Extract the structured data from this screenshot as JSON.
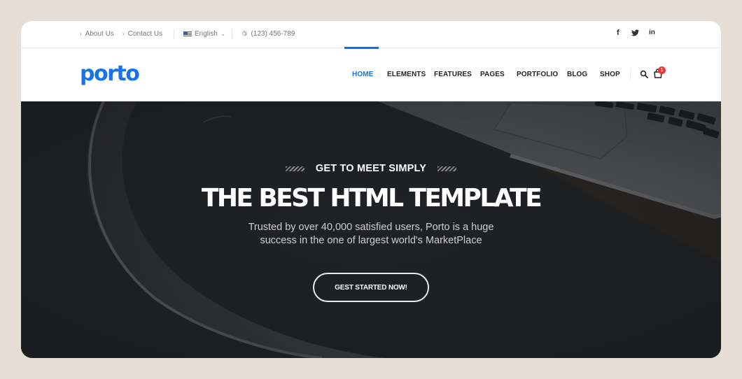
{
  "topbar": {
    "links": [
      {
        "label": "About Us",
        "icon": "chevron-right-icon"
      },
      {
        "label": "Contact Us",
        "icon": "chevron-right-icon"
      }
    ],
    "language": {
      "label": "English",
      "flag": "us-flag-icon"
    },
    "phone": "(123) 456-789",
    "social": [
      {
        "name": "facebook",
        "glyph": "f"
      },
      {
        "name": "twitter",
        "glyph": "🐦"
      },
      {
        "name": "linkedin",
        "glyph": "in"
      }
    ]
  },
  "header": {
    "logo": "porto",
    "brand_color": "#1973e8",
    "nav": [
      {
        "label": "HOME",
        "active": true
      },
      {
        "label": "ELEMENTS",
        "active": false
      },
      {
        "label": "FEATURES",
        "active": false
      },
      {
        "label": "PAGES",
        "active": false
      },
      {
        "label": "PORTFOLIO",
        "active": false
      },
      {
        "label": "BLOG",
        "active": false
      },
      {
        "label": "SHOP",
        "active": false
      }
    ],
    "cart_count": "1"
  },
  "hero": {
    "eyebrow": "GET TO MEET SIMPLY",
    "headline": "THE BEST HTML TEMPLATE",
    "subtitle_line1": "Trusted by over 40,000 satisfied users, Porto is a huge",
    "subtitle_line2": "success in the one of largest world's MarketPlace",
    "cta_label": "GEST STARTED NOW!"
  }
}
